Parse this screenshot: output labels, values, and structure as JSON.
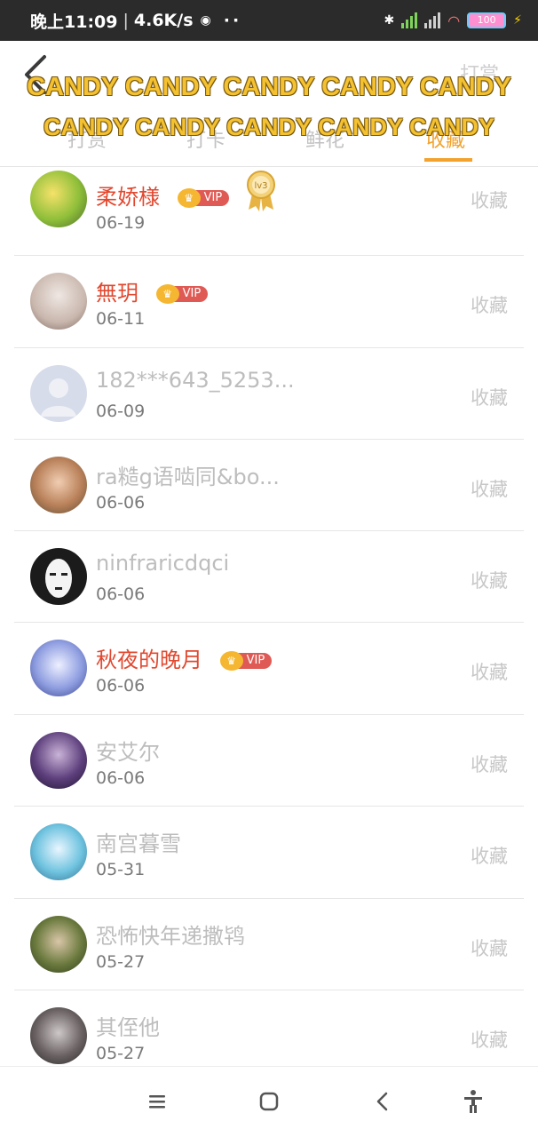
{
  "status_bar": {
    "time": "晚上11:09",
    "network_speed": "4.6K/s",
    "battery": "100"
  },
  "header": {
    "top_right": "打赏",
    "tabs": [
      "打赏",
      "打卡",
      "鲜花",
      "收藏"
    ],
    "active_tab_index": 3,
    "watermark_line1": "CANDY CANDY CANDY CANDY CANDY",
    "watermark_line2": "CANDY CANDY CANDY CANDY CANDY"
  },
  "colors": {
    "accent": "#f2a22d",
    "vip_name": "#e2482f",
    "muted_name": "#bdbdbd"
  },
  "vip_label": "VIP",
  "medal_label": "lv3",
  "favorites": [
    {
      "name": "柔娇様",
      "vip": true,
      "medal": true,
      "date": "06-19",
      "action": "收藏"
    },
    {
      "name": "無玥",
      "vip": true,
      "medal": false,
      "date": "06-11",
      "action": "收藏"
    },
    {
      "name": "182***643_5253...",
      "vip": false,
      "medal": false,
      "date": "06-09",
      "action": "收藏"
    },
    {
      "name": "ra糙g语啮同&bo...",
      "vip": false,
      "medal": false,
      "date": "06-06",
      "action": "收藏"
    },
    {
      "name": "ninfraricdqci",
      "vip": false,
      "medal": false,
      "date": "06-06",
      "action": "收藏"
    },
    {
      "name": "秋夜的晚月",
      "vip": true,
      "medal": false,
      "date": "06-06",
      "action": "收藏"
    },
    {
      "name": "安艾尔",
      "vip": false,
      "medal": false,
      "date": "06-06",
      "action": "收藏"
    },
    {
      "name": "南宫暮雪",
      "vip": false,
      "medal": false,
      "date": "05-31",
      "action": "收藏"
    },
    {
      "name": "恐怖快年递撒鸨",
      "vip": false,
      "medal": false,
      "date": "05-27",
      "action": "收藏"
    },
    {
      "name": "其侄他",
      "vip": false,
      "medal": false,
      "date": "05-27",
      "action": "收藏"
    }
  ]
}
